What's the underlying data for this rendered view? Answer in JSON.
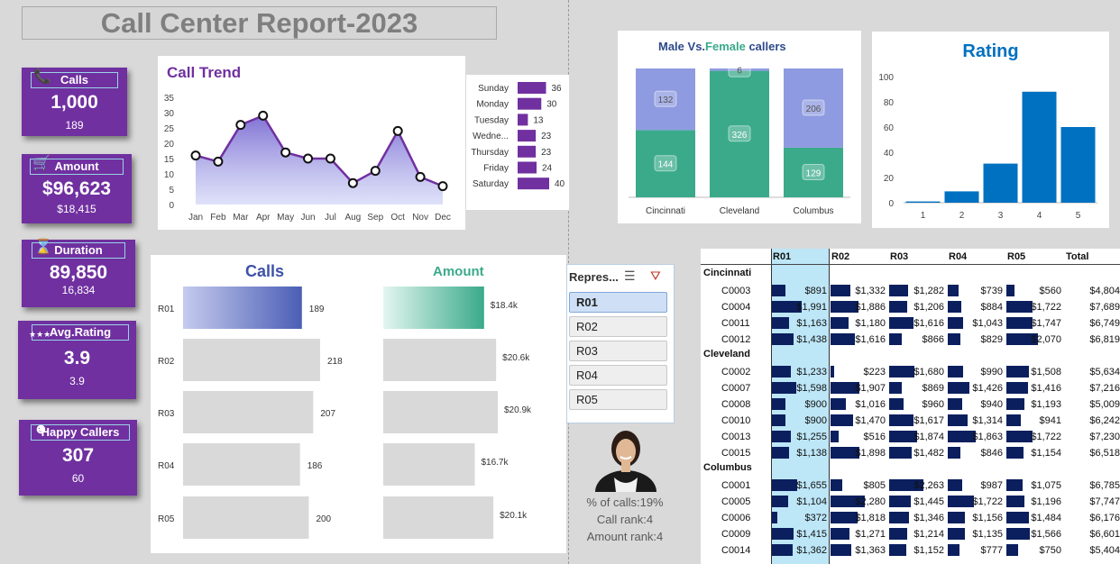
{
  "report_title": "Call Center Report-2023",
  "kpis": [
    {
      "label": "Calls",
      "icon": "phone-icon",
      "value": "1,000",
      "sub": "189"
    },
    {
      "label": "Amount",
      "icon": "cart-icon",
      "value": "$96,623",
      "sub": "$18,415"
    },
    {
      "label": "Duration",
      "icon": "hourglass-icon",
      "value": "89,850",
      "sub": "16,834"
    },
    {
      "label": "Avg.Rating",
      "icon": "stars-icon",
      "value": "3.9",
      "sub": "3.9"
    },
    {
      "label": "Happy Callers",
      "icon": "smiley-icon",
      "value": "307",
      "sub": "60"
    }
  ],
  "colors": {
    "kpi_bg": "#7030a0",
    "trend_line": "#7030a0",
    "female": "#3aaa8a",
    "male": "#8f9be0",
    "rating_bar": "#0070c0",
    "pivot_bar": "#0b1f5e"
  },
  "call_trend": {
    "title": "Call Trend",
    "months": [
      "Jan",
      "Feb",
      "Mar",
      "Apr",
      "May",
      "Jun",
      "Jul",
      "Aug",
      "Sep",
      "Oct",
      "Nov",
      "Dec"
    ],
    "values": [
      16,
      14,
      26,
      29,
      17,
      15,
      15,
      7,
      11,
      24,
      9,
      6
    ],
    "y_ticks": [
      0,
      5,
      10,
      15,
      20,
      25,
      30,
      35
    ]
  },
  "weekday_calls": {
    "days": [
      "Sunday",
      "Monday",
      "Tuesday",
      "Wedne...",
      "Thursday",
      "Friday",
      "Saturday"
    ],
    "values": [
      36,
      30,
      13,
      23,
      23,
      24,
      40
    ]
  },
  "gender_chart": {
    "title_male": "Male",
    "title_vs": " Vs.",
    "title_female": "Female",
    "title_rest": " callers",
    "cities": [
      "Cincinnati",
      "Cleveland",
      "Columbus"
    ],
    "male": [
      132,
      6,
      206
    ],
    "female": [
      144,
      326,
      129
    ]
  },
  "rating_chart": {
    "title": "Rating",
    "categories": [
      "1",
      "2",
      "3",
      "4",
      "5"
    ],
    "values": [
      1,
      9,
      31,
      88,
      60
    ],
    "y_ticks": [
      0,
      20,
      40,
      60,
      80,
      100
    ]
  },
  "rep_bars": {
    "calls_title": "Calls",
    "amount_title": "Amount",
    "reps": [
      "R01",
      "R02",
      "R03",
      "R04",
      "R05"
    ],
    "calls": [
      189,
      218,
      207,
      186,
      200
    ],
    "amounts": [
      18.4,
      20.6,
      20.9,
      16.7,
      20.1
    ],
    "amount_labels": [
      "$18.4k",
      "$20.6k",
      "$20.9k",
      "$16.7k",
      "$20.1k"
    ],
    "selected": "R01"
  },
  "slicer": {
    "header": "Repres...",
    "items": [
      "R01",
      "R02",
      "R03",
      "R04",
      "R05"
    ],
    "selected": "R01"
  },
  "rep_stats": {
    "pct_calls": "% of calls:19%",
    "call_rank": "Call rank:4",
    "amount_rank": "Amount rank:4"
  },
  "pivot": {
    "columns": [
      "R01",
      "R02",
      "R03",
      "R04",
      "R05",
      "Total"
    ],
    "groups": [
      {
        "city": "Cincinnati",
        "rows": [
          {
            "id": "C0003",
            "vals": [
              "$891",
              "$1,332",
              "$1,282",
              "$739",
              "$560"
            ],
            "nums": [
              891,
              1332,
              1282,
              739,
              560
            ],
            "total": "$4,804"
          },
          {
            "id": "C0004",
            "vals": [
              "$1,991",
              "$1,886",
              "$1,206",
              "$884",
              "$1,722"
            ],
            "nums": [
              1991,
              1886,
              1206,
              884,
              1722
            ],
            "total": "$7,689"
          },
          {
            "id": "C0011",
            "vals": [
              "$1,163",
              "$1,180",
              "$1,616",
              "$1,043",
              "$1,747"
            ],
            "nums": [
              1163,
              1180,
              1616,
              1043,
              1747
            ],
            "total": "$6,749"
          },
          {
            "id": "C0012",
            "vals": [
              "$1,438",
              "$1,616",
              "$866",
              "$829",
              "$2,070"
            ],
            "nums": [
              1438,
              1616,
              866,
              829,
              2070
            ],
            "total": "$6,819"
          }
        ]
      },
      {
        "city": "Cleveland",
        "rows": [
          {
            "id": "C0002",
            "vals": [
              "$1,233",
              "$223",
              "$1,680",
              "$990",
              "$1,508"
            ],
            "nums": [
              1233,
              223,
              1680,
              990,
              1508
            ],
            "total": "$5,634"
          },
          {
            "id": "C0007",
            "vals": [
              "$1,598",
              "$1,907",
              "$869",
              "$1,426",
              "$1,416"
            ],
            "nums": [
              1598,
              1907,
              869,
              1426,
              1416
            ],
            "total": "$7,216"
          },
          {
            "id": "C0008",
            "vals": [
              "$900",
              "$1,016",
              "$960",
              "$940",
              "$1,193"
            ],
            "nums": [
              900,
              1016,
              960,
              940,
              1193
            ],
            "total": "$5,009"
          },
          {
            "id": "C0010",
            "vals": [
              "$900",
              "$1,470",
              "$1,617",
              "$1,314",
              "$941"
            ],
            "nums": [
              900,
              1470,
              1617,
              1314,
              941
            ],
            "total": "$6,242"
          },
          {
            "id": "C0013",
            "vals": [
              "$1,255",
              "$516",
              "$1,874",
              "$1,863",
              "$1,722"
            ],
            "nums": [
              1255,
              516,
              1874,
              1863,
              1722
            ],
            "total": "$7,230"
          },
          {
            "id": "C0015",
            "vals": [
              "$1,138",
              "$1,898",
              "$1,482",
              "$846",
              "$1,154"
            ],
            "nums": [
              1138,
              1898,
              1482,
              846,
              1154
            ],
            "total": "$6,518"
          }
        ]
      },
      {
        "city": "Columbus",
        "rows": [
          {
            "id": "C0001",
            "vals": [
              "$1,655",
              "$805",
              "$2,263",
              "$987",
              "$1,075"
            ],
            "nums": [
              1655,
              805,
              2263,
              987,
              1075
            ],
            "total": "$6,785"
          },
          {
            "id": "C0005",
            "vals": [
              "$1,104",
              "$2,280",
              "$1,445",
              "$1,722",
              "$1,196"
            ],
            "nums": [
              1104,
              2280,
              1445,
              1722,
              1196
            ],
            "total": "$7,747"
          },
          {
            "id": "C0006",
            "vals": [
              "$372",
              "$1,818",
              "$1,346",
              "$1,156",
              "$1,484"
            ],
            "nums": [
              372,
              1818,
              1346,
              1156,
              1484
            ],
            "total": "$6,176"
          },
          {
            "id": "C0009",
            "vals": [
              "$1,415",
              "$1,271",
              "$1,214",
              "$1,135",
              "$1,566"
            ],
            "nums": [
              1415,
              1271,
              1214,
              1135,
              1566
            ],
            "total": "$6,601"
          },
          {
            "id": "C0014",
            "vals": [
              "$1,362",
              "$1,363",
              "$1,152",
              "$777",
              "$750"
            ],
            "nums": [
              1362,
              1363,
              1152,
              777,
              750
            ],
            "total": "$5,404"
          }
        ]
      }
    ]
  },
  "chart_data": [
    {
      "type": "area",
      "title": "Call Trend",
      "categories": [
        "Jan",
        "Feb",
        "Mar",
        "Apr",
        "May",
        "Jun",
        "Jul",
        "Aug",
        "Sep",
        "Oct",
        "Nov",
        "Dec"
      ],
      "values": [
        16,
        14,
        26,
        29,
        17,
        15,
        15,
        7,
        11,
        24,
        9,
        6
      ],
      "ylim": [
        0,
        35
      ]
    },
    {
      "type": "bar",
      "categories": [
        "Sunday",
        "Monday",
        "Tuesday",
        "Wedne...",
        "Thursday",
        "Friday",
        "Saturday"
      ],
      "values": [
        36,
        30,
        13,
        23,
        23,
        24,
        40
      ]
    },
    {
      "type": "bar",
      "title": "Male Vs.Female callers",
      "categories": [
        "Cincinnati",
        "Cleveland",
        "Columbus"
      ],
      "series": [
        {
          "name": "Female",
          "values": [
            144,
            326,
            129
          ]
        },
        {
          "name": "Male",
          "values": [
            132,
            6,
            206
          ]
        }
      ]
    },
    {
      "type": "bar",
      "title": "Rating",
      "categories": [
        "1",
        "2",
        "3",
        "4",
        "5"
      ],
      "values": [
        1,
        9,
        31,
        88,
        60
      ],
      "ylim": [
        0,
        100
      ]
    },
    {
      "type": "bar",
      "title": "Calls",
      "categories": [
        "R01",
        "R02",
        "R03",
        "R04",
        "R05"
      ],
      "values": [
        189,
        218,
        207,
        186,
        200
      ]
    },
    {
      "type": "bar",
      "title": "Amount",
      "categories": [
        "R01",
        "R02",
        "R03",
        "R04",
        "R05"
      ],
      "values": [
        18.4,
        20.6,
        20.9,
        16.7,
        20.1
      ]
    }
  ]
}
